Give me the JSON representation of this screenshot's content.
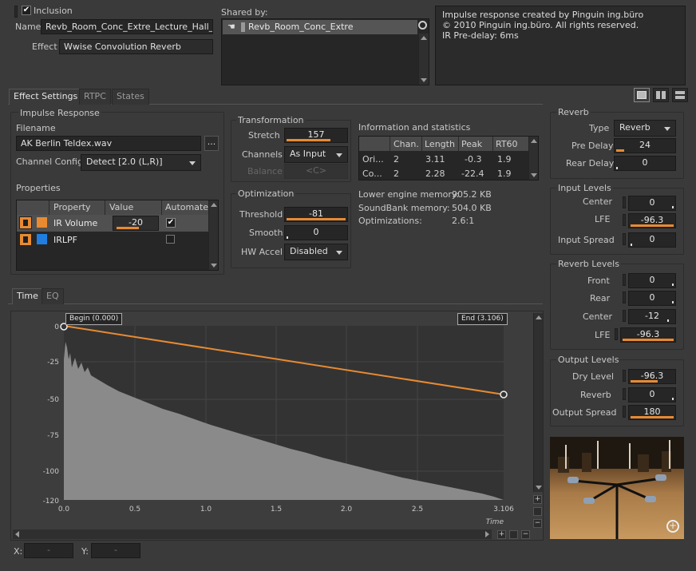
{
  "header": {
    "inclusion_label": "Inclusion",
    "name_label": "Name",
    "name_value": "Revb_Room_Conc_Extre_Lecture_Hall_St",
    "effect_label": "Effect",
    "effect_value": "Wwise Convolution Reverb",
    "shared_by_label": "Shared by:",
    "shared_item": "Revb_Room_Conc_Extre",
    "notes": [
      "Impulse response created by Pinguin ing.büro",
      "© 2010 Pinguin ing.büro.  All rights reserved.",
      "IR Pre-delay: 6ms"
    ]
  },
  "tabs": [
    "Effect Settings",
    "RTPC",
    "States"
  ],
  "impulse": {
    "group_title": "Impulse Response",
    "filename_label": "Filename",
    "filename_value": "AK Berlin Teldex.wav",
    "browse_label": "...",
    "channel_config_label": "Channel Config",
    "channel_config_value": "Detect [2.0 (L,R)]"
  },
  "properties": {
    "title": "Properties",
    "headers": [
      "Property",
      "Value",
      "Automate"
    ],
    "rows": [
      {
        "name": "IR Volume",
        "value": "-20",
        "color": "#e88a32"
      },
      {
        "name": "IRLPF",
        "value": "",
        "color": "#1f7ee0"
      }
    ]
  },
  "transformation": {
    "title": "Transformation",
    "stretch_label": "Stretch",
    "stretch_value": "157",
    "channels_label": "Channels",
    "channels_value": "As Input",
    "balance_label": "Balance",
    "balance_value": "<C>"
  },
  "optimization": {
    "title": "Optimization",
    "threshold_label": "Threshold",
    "threshold_value": "-81",
    "smooth_label": "Smooth",
    "smooth_value": "0",
    "hwaccel_label": "HW Accel",
    "hwaccel_value": "Disabled"
  },
  "info": {
    "title": "Information and statistics",
    "headers": [
      "Chan.",
      "Length",
      "Peak",
      "RT60"
    ],
    "rows": [
      [
        "Ori...",
        "2",
        "3.11",
        "-0.3",
        "1.9"
      ],
      [
        "Co...",
        "2",
        "2.28",
        "-22.4",
        "1.9"
      ]
    ],
    "lower_engine_label": "Lower engine memory:",
    "lower_engine_value": "905.2 KB",
    "soundbank_label": "SoundBank memory:",
    "soundbank_value": "504.0 KB",
    "optimizations_label": "Optimizations:",
    "optimizations_value": "2.6:1"
  },
  "reverb": {
    "title": "Reverb",
    "type_label": "Type",
    "type_value": "Reverb",
    "predelay_label": "Pre Delay",
    "predelay_value": "24",
    "reardelay_label": "Rear Delay",
    "reardelay_value": "0"
  },
  "input_levels": {
    "title": "Input Levels",
    "center_label": "Center",
    "center_value": "0",
    "lfe_label": "LFE",
    "lfe_value": "-96.3",
    "spread_label": "Input Spread",
    "spread_value": "0"
  },
  "reverb_levels": {
    "title": "Reverb Levels",
    "front_label": "Front",
    "front_value": "0",
    "rear_label": "Rear",
    "rear_value": "0",
    "center_label": "Center",
    "center_value": "-12",
    "lfe_label": "LFE",
    "lfe_value": "-96.3"
  },
  "output_levels": {
    "title": "Output Levels",
    "dry_label": "Dry Level",
    "dry_value": "-96.3",
    "reverb_label": "Reverb",
    "reverb_value": "0",
    "spread_label": "Output Spread",
    "spread_value": "180"
  },
  "graph_tabs": [
    "Time",
    "EQ"
  ],
  "graph": {
    "begin_label": "Begin (0.000)",
    "end_label": "End (3.106)",
    "y_ticks": [
      "0",
      "-25",
      "-50",
      "-75",
      "-100",
      "-120"
    ],
    "x_ticks": [
      "0.0",
      "0.5",
      "1.0",
      "1.5",
      "2.0",
      "2.5",
      "3.106"
    ],
    "x_axis_label": "Time",
    "x_coord_label": "X:",
    "y_coord_label": "Y:",
    "x_coord_value": "-",
    "y_coord_value": "-"
  }
}
